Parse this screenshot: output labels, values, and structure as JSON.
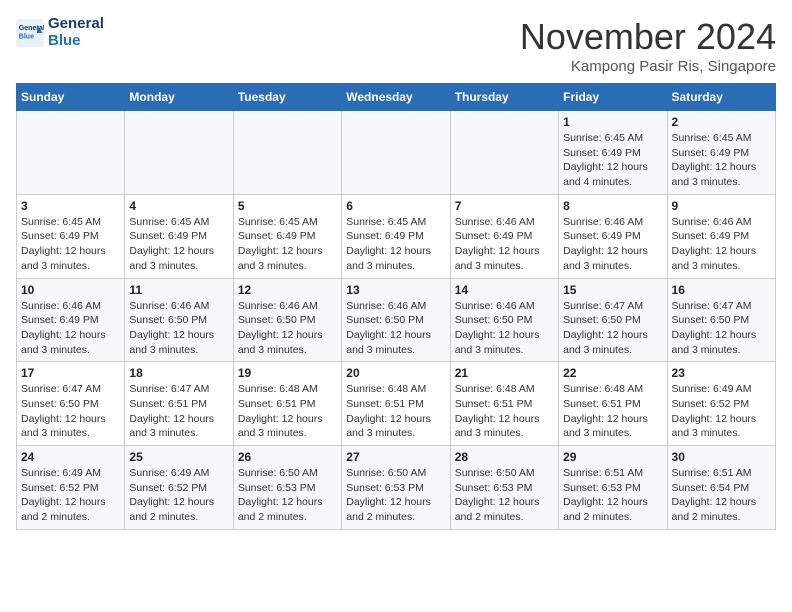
{
  "logo": {
    "line1": "General",
    "line2": "Blue"
  },
  "title": "November 2024",
  "location": "Kampong Pasir Ris, Singapore",
  "weekdays": [
    "Sunday",
    "Monday",
    "Tuesday",
    "Wednesday",
    "Thursday",
    "Friday",
    "Saturday"
  ],
  "weeks": [
    [
      {
        "day": "",
        "details": ""
      },
      {
        "day": "",
        "details": ""
      },
      {
        "day": "",
        "details": ""
      },
      {
        "day": "",
        "details": ""
      },
      {
        "day": "",
        "details": ""
      },
      {
        "day": "1",
        "details": "Sunrise: 6:45 AM\nSunset: 6:49 PM\nDaylight: 12 hours\nand 4 minutes."
      },
      {
        "day": "2",
        "details": "Sunrise: 6:45 AM\nSunset: 6:49 PM\nDaylight: 12 hours\nand 3 minutes."
      }
    ],
    [
      {
        "day": "3",
        "details": "Sunrise: 6:45 AM\nSunset: 6:49 PM\nDaylight: 12 hours\nand 3 minutes."
      },
      {
        "day": "4",
        "details": "Sunrise: 6:45 AM\nSunset: 6:49 PM\nDaylight: 12 hours\nand 3 minutes."
      },
      {
        "day": "5",
        "details": "Sunrise: 6:45 AM\nSunset: 6:49 PM\nDaylight: 12 hours\nand 3 minutes."
      },
      {
        "day": "6",
        "details": "Sunrise: 6:45 AM\nSunset: 6:49 PM\nDaylight: 12 hours\nand 3 minutes."
      },
      {
        "day": "7",
        "details": "Sunrise: 6:46 AM\nSunset: 6:49 PM\nDaylight: 12 hours\nand 3 minutes."
      },
      {
        "day": "8",
        "details": "Sunrise: 6:46 AM\nSunset: 6:49 PM\nDaylight: 12 hours\nand 3 minutes."
      },
      {
        "day": "9",
        "details": "Sunrise: 6:46 AM\nSunset: 6:49 PM\nDaylight: 12 hours\nand 3 minutes."
      }
    ],
    [
      {
        "day": "10",
        "details": "Sunrise: 6:46 AM\nSunset: 6:49 PM\nDaylight: 12 hours\nand 3 minutes."
      },
      {
        "day": "11",
        "details": "Sunrise: 6:46 AM\nSunset: 6:50 PM\nDaylight: 12 hours\nand 3 minutes."
      },
      {
        "day": "12",
        "details": "Sunrise: 6:46 AM\nSunset: 6:50 PM\nDaylight: 12 hours\nand 3 minutes."
      },
      {
        "day": "13",
        "details": "Sunrise: 6:46 AM\nSunset: 6:50 PM\nDaylight: 12 hours\nand 3 minutes."
      },
      {
        "day": "14",
        "details": "Sunrise: 6:46 AM\nSunset: 6:50 PM\nDaylight: 12 hours\nand 3 minutes."
      },
      {
        "day": "15",
        "details": "Sunrise: 6:47 AM\nSunset: 6:50 PM\nDaylight: 12 hours\nand 3 minutes."
      },
      {
        "day": "16",
        "details": "Sunrise: 6:47 AM\nSunset: 6:50 PM\nDaylight: 12 hours\nand 3 minutes."
      }
    ],
    [
      {
        "day": "17",
        "details": "Sunrise: 6:47 AM\nSunset: 6:50 PM\nDaylight: 12 hours\nand 3 minutes."
      },
      {
        "day": "18",
        "details": "Sunrise: 6:47 AM\nSunset: 6:51 PM\nDaylight: 12 hours\nand 3 minutes."
      },
      {
        "day": "19",
        "details": "Sunrise: 6:48 AM\nSunset: 6:51 PM\nDaylight: 12 hours\nand 3 minutes."
      },
      {
        "day": "20",
        "details": "Sunrise: 6:48 AM\nSunset: 6:51 PM\nDaylight: 12 hours\nand 3 minutes."
      },
      {
        "day": "21",
        "details": "Sunrise: 6:48 AM\nSunset: 6:51 PM\nDaylight: 12 hours\nand 3 minutes."
      },
      {
        "day": "22",
        "details": "Sunrise: 6:48 AM\nSunset: 6:51 PM\nDaylight: 12 hours\nand 3 minutes."
      },
      {
        "day": "23",
        "details": "Sunrise: 6:49 AM\nSunset: 6:52 PM\nDaylight: 12 hours\nand 3 minutes."
      }
    ],
    [
      {
        "day": "24",
        "details": "Sunrise: 6:49 AM\nSunset: 6:52 PM\nDaylight: 12 hours\nand 2 minutes."
      },
      {
        "day": "25",
        "details": "Sunrise: 6:49 AM\nSunset: 6:52 PM\nDaylight: 12 hours\nand 2 minutes."
      },
      {
        "day": "26",
        "details": "Sunrise: 6:50 AM\nSunset: 6:53 PM\nDaylight: 12 hours\nand 2 minutes."
      },
      {
        "day": "27",
        "details": "Sunrise: 6:50 AM\nSunset: 6:53 PM\nDaylight: 12 hours\nand 2 minutes."
      },
      {
        "day": "28",
        "details": "Sunrise: 6:50 AM\nSunset: 6:53 PM\nDaylight: 12 hours\nand 2 minutes."
      },
      {
        "day": "29",
        "details": "Sunrise: 6:51 AM\nSunset: 6:53 PM\nDaylight: 12 hours\nand 2 minutes."
      },
      {
        "day": "30",
        "details": "Sunrise: 6:51 AM\nSunset: 6:54 PM\nDaylight: 12 hours\nand 2 minutes."
      }
    ]
  ]
}
